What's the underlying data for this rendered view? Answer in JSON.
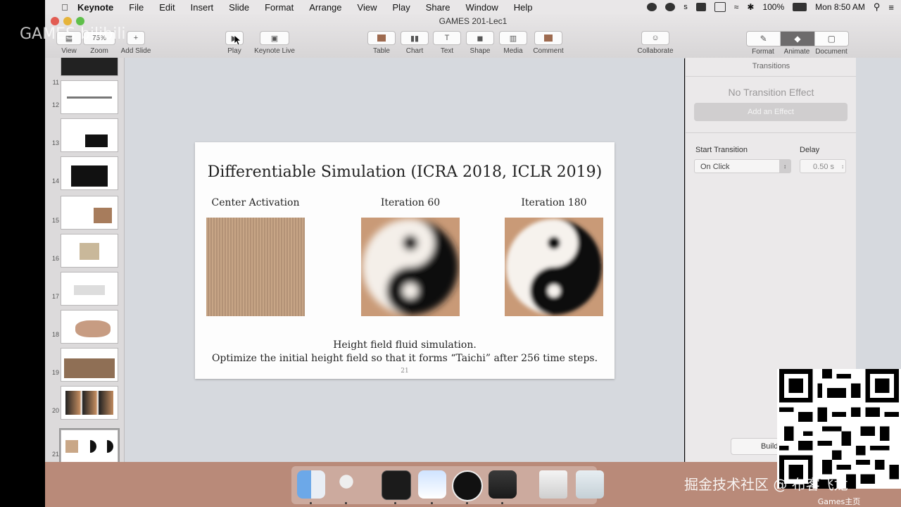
{
  "menubar": {
    "app": "Keynote",
    "items": [
      "File",
      "Edit",
      "Insert",
      "Slide",
      "Format",
      "Arrange",
      "View",
      "Play",
      "Share",
      "Window",
      "Help"
    ],
    "battery": "100%",
    "clock": "Mon 8:50 AM"
  },
  "window": {
    "title": "GAMES 201-Lec1"
  },
  "toolbar": {
    "view": "View",
    "zoom": "Zoom",
    "zoom_value": "75%",
    "add_slide": "Add Slide",
    "play": "Play",
    "keynote_live": "Keynote Live",
    "table": "Table",
    "chart": "Chart",
    "text": "Text",
    "shape": "Shape",
    "media": "Media",
    "comment": "Comment",
    "collaborate": "Collaborate",
    "format": "Format",
    "animate": "Animate",
    "document": "Document"
  },
  "navigator": {
    "slides": [
      {
        "num": "11"
      },
      {
        "num": "12"
      },
      {
        "num": "13"
      },
      {
        "num": "14"
      },
      {
        "num": "15"
      },
      {
        "num": "16"
      },
      {
        "num": "17"
      },
      {
        "num": "18"
      },
      {
        "num": "19"
      },
      {
        "num": "20"
      },
      {
        "num": "21"
      }
    ]
  },
  "slide": {
    "title": "Differentiable Simulation (ICRA 2018, ICLR 2019)",
    "panels": [
      "Center Activation",
      "Iteration 60",
      "Iteration 180"
    ],
    "caption1": "Height field fluid simulation.",
    "caption2": "Optimize the initial height field so that it forms “Taichi” after 256 time steps.",
    "page_number": "21"
  },
  "inspector": {
    "header": "Transitions",
    "no_effect": "No Transition Effect",
    "add_effect": "Add an Effect",
    "start_label": "Start Transition",
    "start_value": "On Click",
    "delay_label": "Delay",
    "delay_value": "0.50 s",
    "build_order": "Build O"
  },
  "overlays": {
    "watermark_left": "GAMES bilibili",
    "watermark_right": "掘金技术社区 @ 布客飞龙",
    "qr_caption": "Games主页"
  },
  "colors": {
    "dock": "#b98a79",
    "canvas": "#d6d9de",
    "texture": "#c9a787"
  }
}
